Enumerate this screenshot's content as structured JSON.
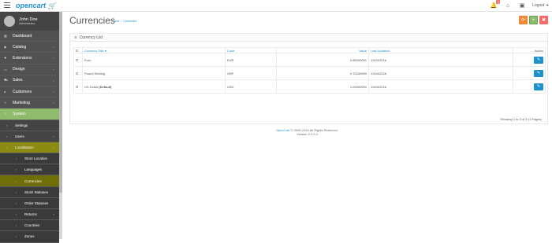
{
  "header": {
    "logo": "opencart",
    "notification_count": "9",
    "logout_label": "Logout"
  },
  "profile": {
    "name": "John Doe",
    "role": "Administrator"
  },
  "sidebar": {
    "items": [
      {
        "label": "Dashboard",
        "icon": "dashboard-icon"
      },
      {
        "label": "Catalog",
        "icon": "tag-icon"
      },
      {
        "label": "Extensions",
        "icon": "puzzle-icon"
      },
      {
        "label": "Design",
        "icon": "monitor-icon"
      },
      {
        "label": "Sales",
        "icon": "cart-icon"
      },
      {
        "label": "Customers",
        "icon": "user-icon"
      },
      {
        "label": "Marketing",
        "icon": "share-icon"
      },
      {
        "label": "System",
        "icon": "gear-icon"
      }
    ],
    "system_sub": [
      "Settings",
      "Users",
      "Localisation"
    ],
    "localisation_sub": [
      "Store Location",
      "Languages",
      "Currencies",
      "Stock Statuses",
      "Order Statuses",
      "Returns",
      "Countries",
      "Zones"
    ]
  },
  "page": {
    "title": "Currencies",
    "breadcrumb_home": "Home",
    "breadcrumb_current": "Currencies"
  },
  "panel": {
    "title": "Currency List",
    "columns": [
      "Currency Title",
      "Code",
      "Value",
      "Last Updated",
      "Action"
    ],
    "rows": [
      {
        "title": "Euro",
        "default": "",
        "code": "EUR",
        "value": "0.88330001",
        "updated": "13/04/2016"
      },
      {
        "title": "Pound Sterling",
        "default": "",
        "code": "GBP",
        "value": "0.70249999",
        "updated": "13/04/2016"
      },
      {
        "title": "US Dollar",
        "default": "(Default)",
        "code": "USD",
        "value": "1.00000000",
        "updated": "13/04/2016"
      }
    ],
    "showing": "Showing 1 to 3 of 3 (1 Pages)"
  },
  "footer": {
    "brand": "OpenCart",
    "copyright": "© 2009-2016 All Rights Reserved.",
    "version": "Version 2.2.0.0"
  }
}
